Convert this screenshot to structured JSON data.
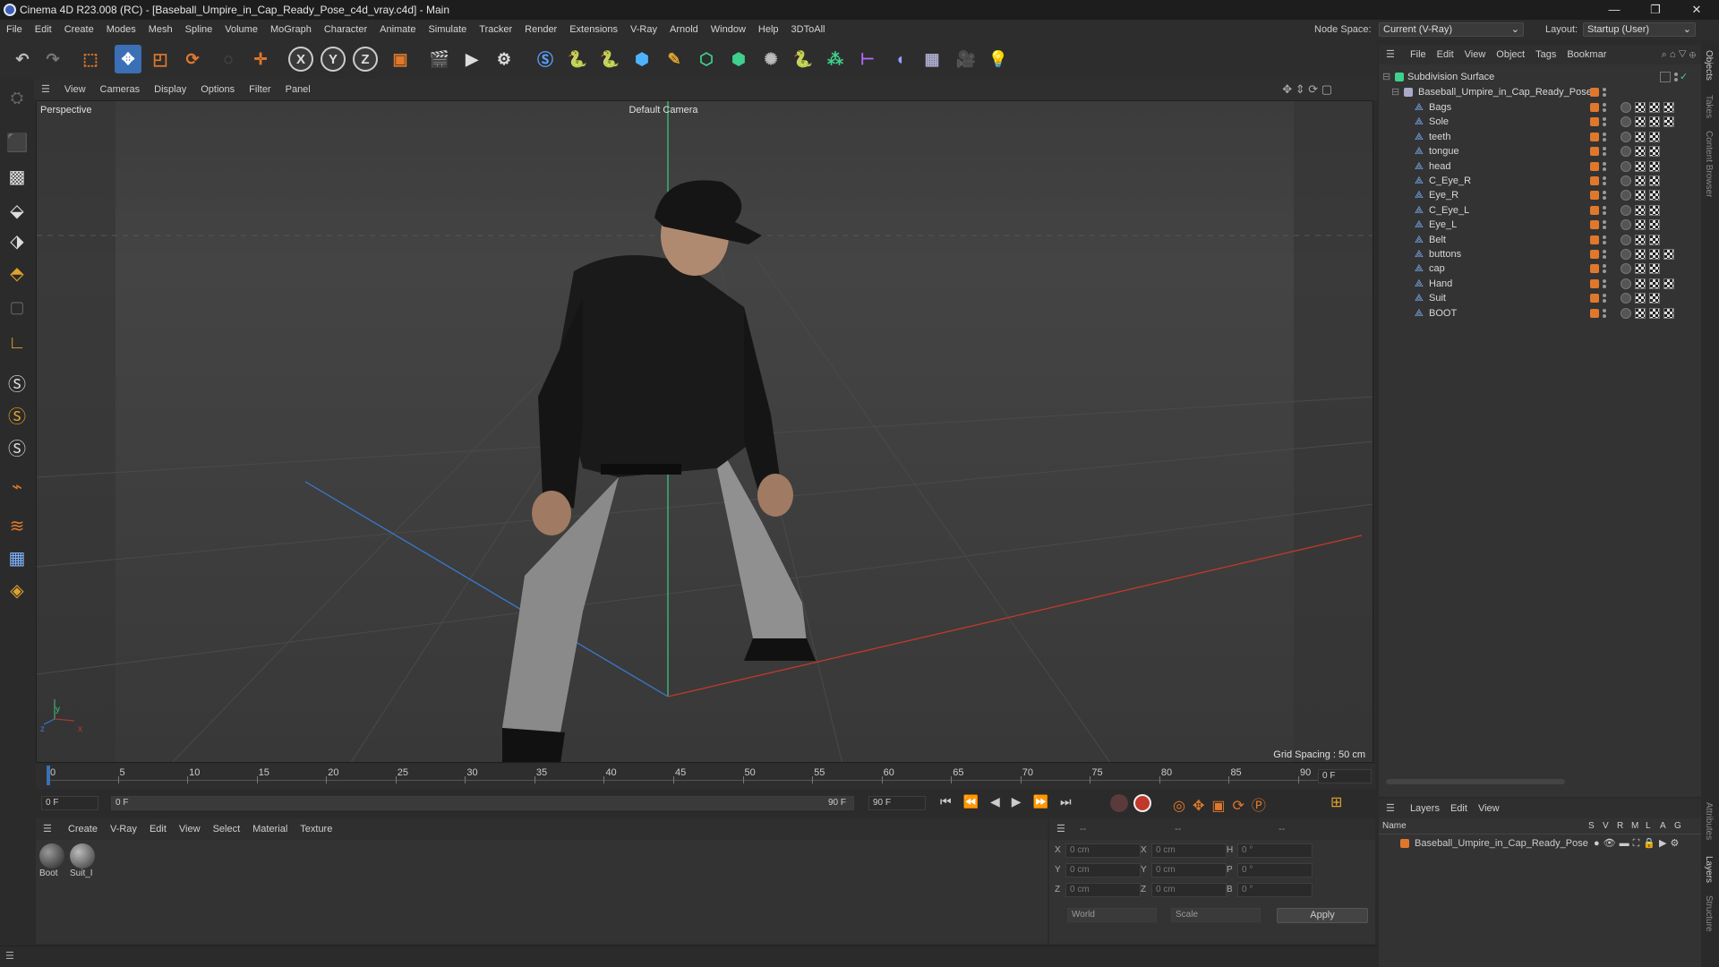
{
  "window": {
    "title": "Cinema 4D R23.008 (RC) - [Baseball_Umpire_in_Cap_Ready_Pose_c4d_vray.c4d] - Main"
  },
  "menu": [
    "File",
    "Edit",
    "Create",
    "Modes",
    "Mesh",
    "Spline",
    "Volume",
    "MoGraph",
    "Character",
    "Animate",
    "Simulate",
    "Tracker",
    "Render",
    "Extensions",
    "V-Ray",
    "Arnold",
    "Window",
    "Help",
    "3DToAll"
  ],
  "node_space": {
    "label": "Node Space:",
    "value": "Current (V-Ray)"
  },
  "layout": {
    "label": "Layout:",
    "value": "Startup (User)"
  },
  "viewport": {
    "menu": [
      "View",
      "Cameras",
      "Display",
      "Options",
      "Filter",
      "Panel"
    ],
    "name": "Perspective",
    "camera": "Default Camera",
    "grid_spacing": "Grid Spacing : 50 cm",
    "axis_x": "x",
    "axis_y": "y",
    "axis_z": "z"
  },
  "timeline": {
    "ticks": [
      "0",
      "5",
      "10",
      "15",
      "20",
      "25",
      "30",
      "35",
      "40",
      "45",
      "50",
      "55",
      "60",
      "65",
      "70",
      "75",
      "80",
      "85",
      "90"
    ],
    "current_frame": "0 F"
  },
  "transport": {
    "start": "0 F",
    "range_start": "0 F",
    "range_end": "90 F",
    "end": "90 F"
  },
  "materials": {
    "menu": [
      "Create",
      "V-Ray",
      "Edit",
      "View",
      "Select",
      "Material",
      "Texture"
    ],
    "items": [
      "Boot",
      "Suit_I"
    ]
  },
  "attributes": {
    "header1": "--",
    "header2": "--",
    "header3": "--",
    "rows": [
      {
        "l1": "X",
        "v1": "0 cm",
        "l2": "X",
        "v2": "0 cm",
        "l3": "H",
        "v3": "0 °"
      },
      {
        "l1": "Y",
        "v1": "0 cm",
        "l2": "Y",
        "v2": "0 cm",
        "l3": "P",
        "v3": "0 °"
      },
      {
        "l1": "Z",
        "v1": "0 cm",
        "l2": "Z",
        "v2": "0 cm",
        "l3": "B",
        "v3": "0 °"
      }
    ],
    "coord_mode": "World",
    "size_mode": "Scale",
    "apply": "Apply"
  },
  "objects": {
    "menu": [
      "File",
      "Edit",
      "View",
      "Object",
      "Tags",
      "Bookmar"
    ],
    "root": "Subdivision Surface",
    "group": "Baseball_Umpire_in_Cap_Ready_Pose",
    "children": [
      {
        "name": "Bags",
        "tags": 3
      },
      {
        "name": "Sole",
        "tags": 3
      },
      {
        "name": "teeth",
        "tags": 2
      },
      {
        "name": "tongue",
        "tags": 2
      },
      {
        "name": "head",
        "tags": 2
      },
      {
        "name": "C_Eye_R",
        "tags": 2
      },
      {
        "name": "Eye_R",
        "tags": 2
      },
      {
        "name": "C_Eye_L",
        "tags": 2
      },
      {
        "name": "Eye_L",
        "tags": 2
      },
      {
        "name": "Belt",
        "tags": 2
      },
      {
        "name": "buttons",
        "tags": 3
      },
      {
        "name": "cap",
        "tags": 2
      },
      {
        "name": "Hand",
        "tags": 3
      },
      {
        "name": "Suit",
        "tags": 2
      },
      {
        "name": "BOOT",
        "tags": 3
      }
    ]
  },
  "layers": {
    "menu": [
      "Layers",
      "Edit",
      "View"
    ],
    "columns": [
      "Name",
      "S",
      "V",
      "R",
      "M",
      "L",
      "A",
      "G"
    ],
    "items": [
      "Baseball_Umpire_in_Cap_Ready_Pose"
    ]
  },
  "side_tabs": [
    "Objects",
    "Takes",
    "Content Browser",
    "Attributes",
    "Layers",
    "Structure"
  ],
  "colors": {
    "accent": "#e0782c",
    "blue_select": "#3b6fb6"
  }
}
